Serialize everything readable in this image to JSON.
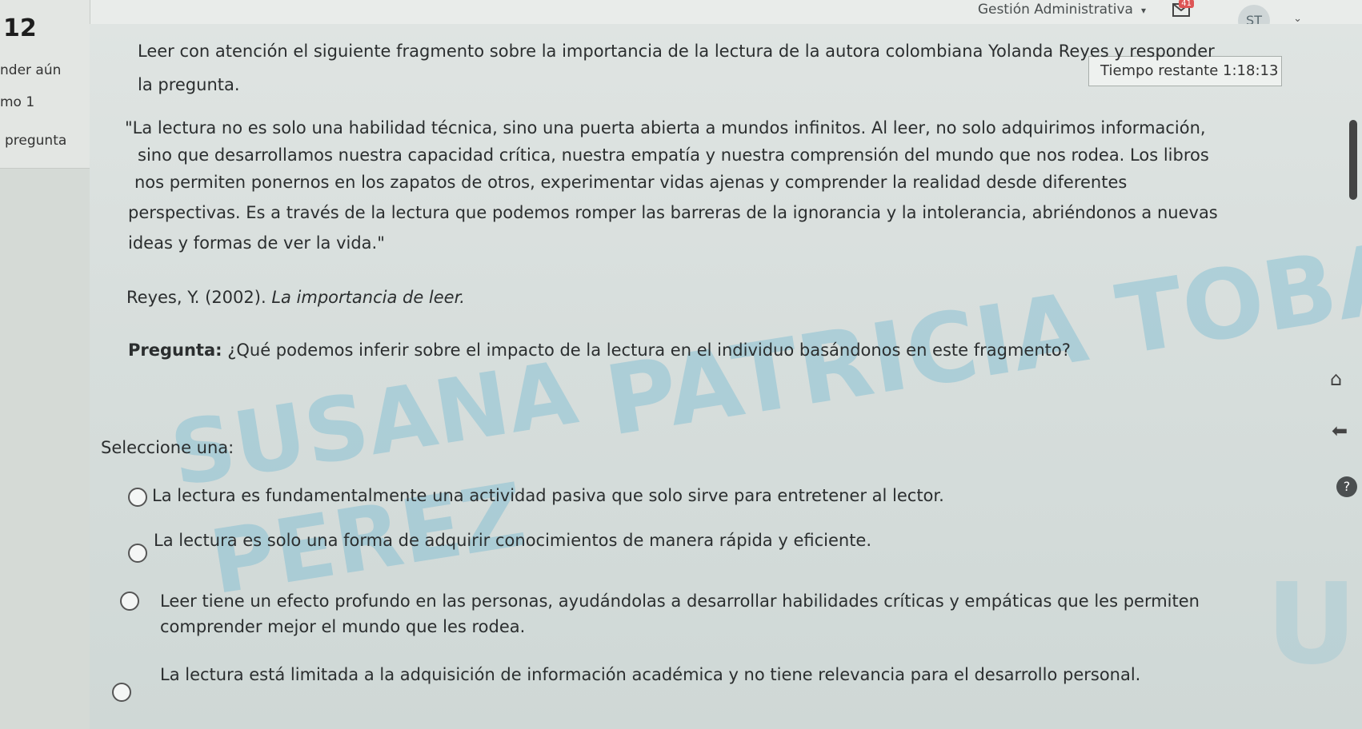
{
  "topbar": {
    "menu_label": "Gestión Administrativa",
    "notifications_count": "41",
    "avatar_initials": "ST"
  },
  "left_panel": {
    "question_number": "12",
    "state": "nder aún",
    "mark": "mo 1",
    "flag": "pregunta"
  },
  "timer": {
    "label": "Tiempo restante",
    "value": "1:18:13"
  },
  "question": {
    "intro_line1": "Leer con atención el siguiente fragmento sobre la importancia de la lectura de la autora colombiana Yolanda Reyes y responder",
    "intro_line2": "la pregunta.",
    "quote_lines": [
      "\"La lectura no es solo una habilidad técnica, sino una puerta abierta a mundos infinitos. Al leer, no solo adquirimos información,",
      "sino que desarrollamos nuestra capacidad crítica, nuestra empatía y nuestra comprensión del mundo que nos rodea. Los libros",
      "nos permiten ponernos en los zapatos de otros, experimentar vidas ajenas y comprender la realidad desde diferentes",
      "perspectivas. Es a través de la lectura que podemos romper las barreras de la ignorancia y la intolerancia, abriéndonos a nuevas",
      "ideas y formas de ver la vida.\""
    ],
    "reference_author": "Reyes, Y. (2002). ",
    "reference_title": "La importancia de leer.",
    "prompt_label": "Pregunta:",
    "prompt_text": " ¿Qué podemos inferir sobre el impacto de la lectura en el individuo basándonos en este fragmento?",
    "select_label": "Seleccione una:",
    "options": [
      {
        "line1": "La lectura es fundamentalmente una actividad pasiva que solo sirve para entretener al lector."
      },
      {
        "line1": "La lectura es solo una forma de adquirir conocimientos de manera rápida y eficiente."
      },
      {
        "line1": "Leer tiene un efecto profundo en las personas, ayudándolas a desarrollar habilidades críticas y empáticas que les permiten",
        "line2": "comprender mejor el mundo que les rodea."
      },
      {
        "line1": "La lectura está limitada a la adquisición de información académica y no tiene relevancia para el desarrollo personal."
      }
    ]
  },
  "watermark": {
    "line1": "PATRICIA TOBAR",
    "line2": "SUSANA",
    "line3": "PEREZ",
    "logo": "UN"
  },
  "tools": {
    "home": "home-icon",
    "back": "back-arrow-icon",
    "help": "?"
  }
}
